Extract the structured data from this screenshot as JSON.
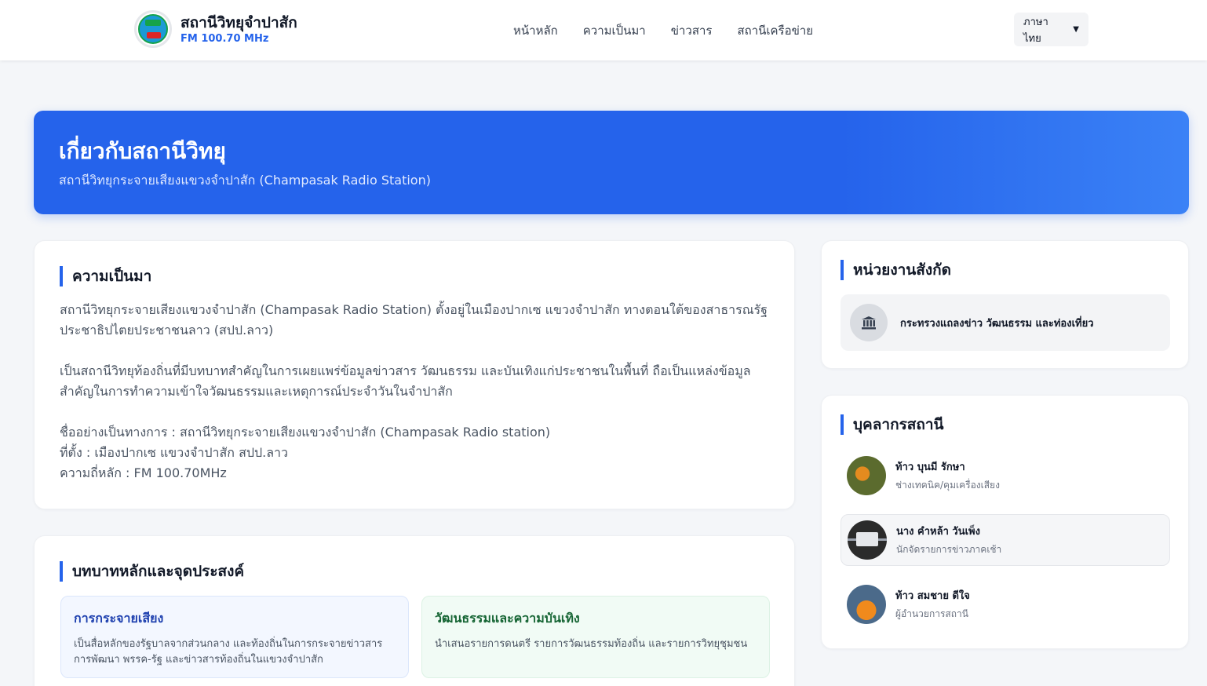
{
  "header": {
    "brand_title": "สถานีวิทยุจำปาสัก",
    "brand_sub": "FM 100.70 MHz",
    "nav": [
      "หน้าหลัก",
      "ความเป็นมา",
      "ข่าวสาร",
      "สถานีเครือข่าย"
    ],
    "language": "ภาษาไทย"
  },
  "hero": {
    "title": "เกี่ยวกับสถานีวิทยุ",
    "subtitle": "สถานีวิทยุกระจายเสียงแขวงจำปาสัก (Champasak Radio Station)"
  },
  "history": {
    "title": "ความเป็นมา",
    "p1": "สถานีวิทยุกระจายเสียงแขวงจำปาสัก (Champasak Radio Station) ตั้งอยู่ในเมืองปากเซ แขวงจำปาสัก ทางตอนใต้ของสาธารณรัฐประชาธิปไตยประชาชนลาว (สปป.ลาว)",
    "p2": "เป็นสถานีวิทยุท้องถิ่นที่มีบทบาทสำคัญในการเผยแพร่ข้อมูลข่าวสาร วัฒนธรรม และบันเทิงแก่ประชาชนในพื้นที่ ถือเป็นแหล่งข้อมูลสำคัญในการทำความเข้าใจวัฒนธรรมและเหตุการณ์ประจำวันในจำปาสัก",
    "official_name": "ชื่ออย่างเป็นทางการ : สถานีวิทยุกระจายเสียงแขวงจำปาสัก (Champasak Radio station)",
    "location": "ที่ตั้ง : เมืองปากเซ แขวงจำปาสัก สปป.ลาว",
    "frequency": "ความถี่หลัก : FM 100.70MHz"
  },
  "roles": {
    "title": "บทบาทหลักและจุดประสงค์",
    "items": [
      {
        "title": "การกระจายเสียง",
        "text": "เป็นสื่อหลักของรัฐบาลจากส่วนกลาง และท้องถิ่นในการกระจายข่าวสารการพัฒนา พรรค-รัฐ และข่าวสารท้องถิ่นในแขวงจำปาสัก"
      },
      {
        "title": "วัฒนธรรมและความบันเทิง",
        "text": "นำเสนอรายการดนตรี รายการวัฒนธรรมท้องถิ่น และรายการวิทยุชุมชน"
      }
    ]
  },
  "affiliation": {
    "title": "หน่วยงานสังกัด",
    "name": "กระทรวงแถลงข่าว วัฒนธรรม และท่องเที่ยว",
    "icon": "bank-icon"
  },
  "staff": {
    "title": "บุคลากรสถานี",
    "members": [
      {
        "name": "ท้าว บุนมี รักษา",
        "role": "ช่างเทคนิค/คุมเครื่องเสียง"
      },
      {
        "name": "นาง คำหล้า วันเพ็ง",
        "role": "นักจัดรายการข่าวภาคเช้า"
      },
      {
        "name": "ท้าว สมชาย ดีใจ",
        "role": "ผู้อำนวยการสถานี"
      }
    ]
  },
  "colors": {
    "accent": "#2563eb",
    "background": "#f4f6f9"
  }
}
